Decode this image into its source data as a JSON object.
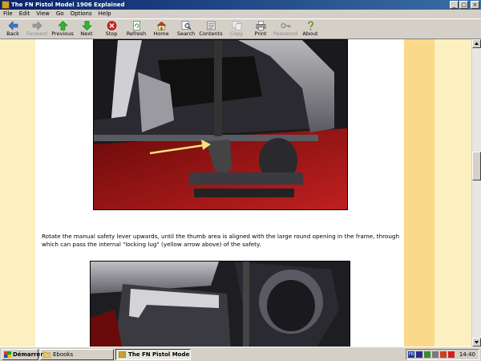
{
  "window": {
    "title": "The FN Pistol Model 1906 Explained",
    "controls": [
      "_",
      "□",
      "×"
    ]
  },
  "menu": [
    "File",
    "Edit",
    "View",
    "Go",
    "Options",
    "Help"
  ],
  "toolbar": {
    "back": "Back",
    "forward": "Forward",
    "previous": "Previous",
    "next": "Next",
    "stop": "Stop",
    "refresh": "Refresh",
    "home": "Home",
    "search": "Search",
    "contents": "Contents",
    "copy": "Copy",
    "print": "Print",
    "password": "Password",
    "about": "About"
  },
  "content": {
    "caption": "Rotate the manual safety lever upwards, until the thumb area is aligned with the large round opening in the frame, through which can pass the internal \"locking lug\" (yellow arrow above) of the safety.",
    "arrow_color": "#f5e27a"
  },
  "colors": {
    "page_bg": "#fdf0c0",
    "stripe": "#fbd98a",
    "titlebar": "#0a246a"
  },
  "taskbar": {
    "start": "Démarrer",
    "tasks": [
      "Ebooks",
      "The FN Pistol Model 19..."
    ],
    "clock": "14:40",
    "tray_lang": "FR"
  }
}
